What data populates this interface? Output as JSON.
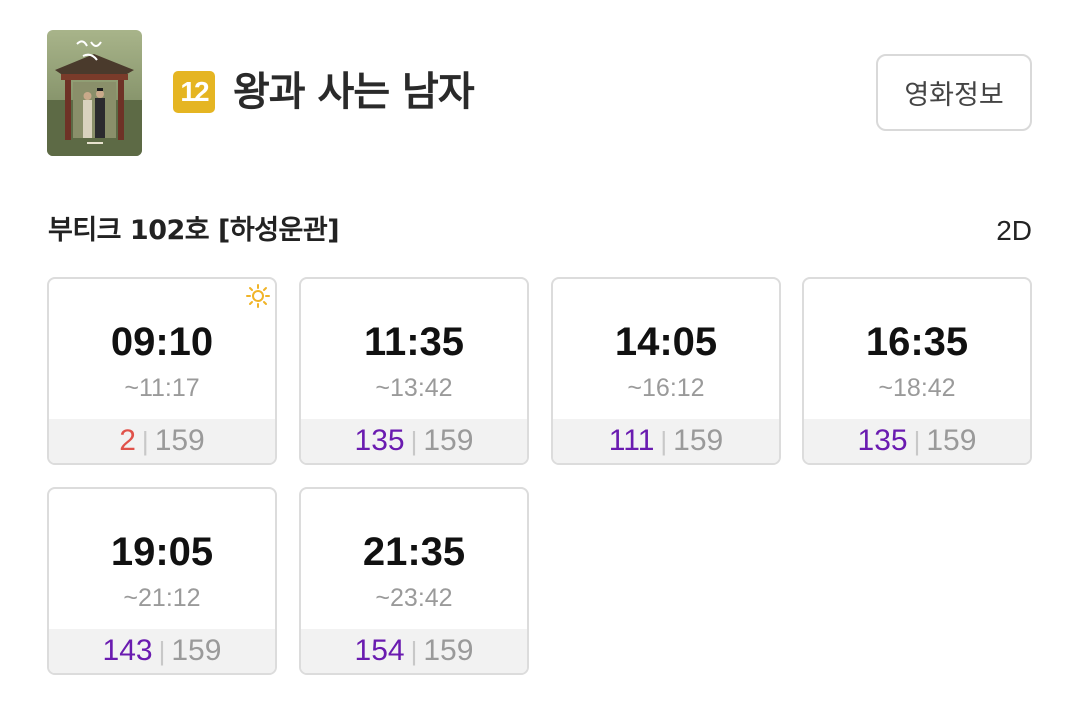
{
  "movie": {
    "rating": "12",
    "title": "왕과 사는 남자",
    "info_button": "영화정보"
  },
  "hall": {
    "name": "부티크 102호 [하성운관]",
    "format": "2D"
  },
  "showtimes": [
    {
      "start": "09:10",
      "end": "~11:17",
      "available": "2",
      "total": "159",
      "morning_icon": "sun-icon"
    },
    {
      "start": "11:35",
      "end": "~13:42",
      "available": "135",
      "total": "159"
    },
    {
      "start": "14:05",
      "end": "~16:12",
      "available": "111",
      "total": "159"
    },
    {
      "start": "16:35",
      "end": "~18:42",
      "available": "135",
      "total": "159"
    },
    {
      "start": "19:05",
      "end": "~21:12",
      "available": "143",
      "total": "159"
    },
    {
      "start": "21:35",
      "end": "~23:42",
      "available": "154",
      "total": "159"
    }
  ],
  "colors": {
    "rating_badge": "#e5b522",
    "seats_available": "#6a1bb0",
    "seats_low": "#e0524a",
    "seats_total": "#9a9a9a",
    "sun_icon": "#f0b429"
  }
}
